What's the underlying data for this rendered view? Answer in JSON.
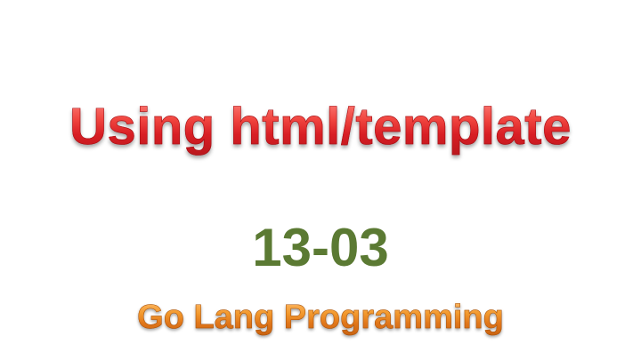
{
  "slide": {
    "title": "Using html/template",
    "lesson_number": "13-03",
    "subtitle": "Go Lang Programming",
    "colors": {
      "title": "#e0252a",
      "lesson_number": "#5b7a33",
      "subtitle": "#e07a1c",
      "background": "#ffffff"
    }
  }
}
